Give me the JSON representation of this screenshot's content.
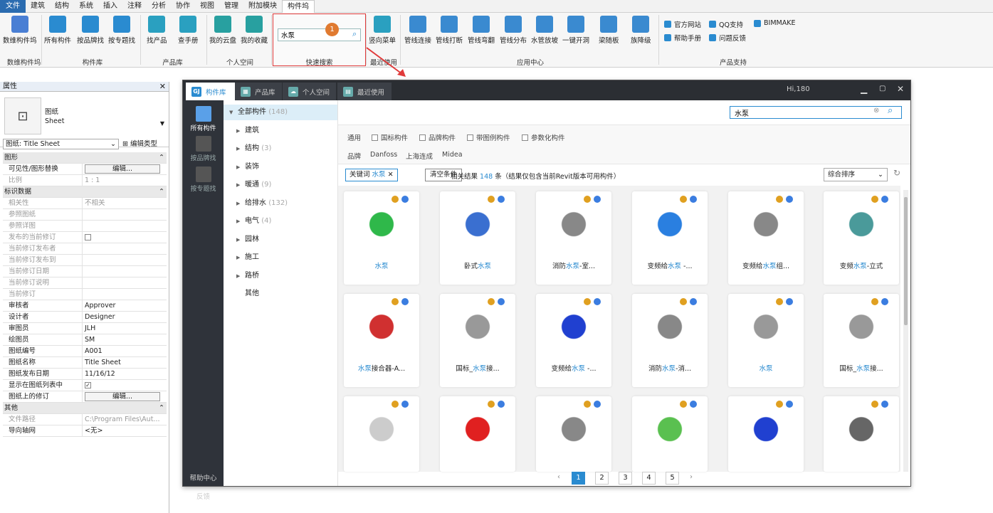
{
  "menu": [
    "文件",
    "建筑",
    "结构",
    "系统",
    "插入",
    "注释",
    "分析",
    "协作",
    "视图",
    "管理",
    "附加模块",
    "构件坞"
  ],
  "ribbon": {
    "buttons": [
      {
        "label": "数维构件坞",
        "color": "#4a7fd4",
        "icon": "hand-icon"
      },
      {
        "label": "所有构件",
        "color": "#2a8bd0",
        "icon": "gj-icon"
      },
      {
        "label": "按品牌找",
        "color": "#2a8bd0",
        "icon": "brand-icon"
      },
      {
        "label": "按专题找",
        "color": "#2a8bd0",
        "icon": "topic-icon"
      },
      {
        "label": "找产品",
        "color": "#2aa0c0",
        "icon": "product-icon"
      },
      {
        "label": "查手册",
        "color": "#2aa0c0",
        "icon": "manual-icon"
      },
      {
        "label": "我的云盘",
        "color": "#28a0a0",
        "icon": "cloud-icon"
      },
      {
        "label": "我的收藏",
        "color": "#28a0a0",
        "icon": "star-icon"
      },
      {
        "label": "竖向菜单",
        "color": "#2aa0c0",
        "icon": "vertical-menu-icon"
      },
      {
        "label": "管线连接",
        "color": "#3a8ad0",
        "icon": "pipe-connect-icon"
      },
      {
        "label": "管线打断",
        "color": "#3a8ad0",
        "icon": "pipe-break-icon"
      },
      {
        "label": "管线弯翻",
        "color": "#3a8ad0",
        "icon": "pipe-bend-icon"
      },
      {
        "label": "管线分布",
        "color": "#3a8ad0",
        "icon": "pipe-distribute-icon"
      },
      {
        "label": "水管放坡",
        "color": "#3a8ad0",
        "icon": "pipe-slope-icon"
      },
      {
        "label": "一键开洞",
        "color": "#3a8ad0",
        "icon": "hole-icon"
      },
      {
        "label": "梁随板",
        "color": "#3a8ad0",
        "icon": "beam-icon"
      },
      {
        "label": "族降级",
        "color": "#3a8ad0",
        "icon": "family-downgrade-icon"
      }
    ],
    "groups": [
      "数维构件坞",
      "构件库",
      "产品库",
      "个人空间",
      "快速搜索",
      "最近使用",
      "应用中心",
      "产品支持"
    ],
    "quick_search": {
      "value": "水泵",
      "badge": "1"
    },
    "support": [
      "官方网站",
      "QQ支持",
      "BIMMAKE",
      "帮助手册",
      "问题反馈"
    ]
  },
  "props": {
    "title": "属性",
    "type_name": "图纸",
    "type_sub": "Sheet",
    "selector": "图纸: Title Sheet",
    "edit_type": "编辑类型",
    "rows": [
      {
        "k": "图形",
        "v": "",
        "sec": true
      },
      {
        "k": "可见性/图形替换",
        "v": "编辑...",
        "btn": true
      },
      {
        "k": "比例",
        "v": "1 : 1",
        "dim": true
      },
      {
        "k": "标识数据",
        "v": "",
        "sec": true
      },
      {
        "k": "相关性",
        "v": "不相关",
        "dim": true
      },
      {
        "k": "参照图纸",
        "v": "",
        "dim": true
      },
      {
        "k": "参照详图",
        "v": "",
        "dim": true
      },
      {
        "k": "发布的当前修订",
        "v": "",
        "cb": "",
        "dim": true
      },
      {
        "k": "当前修订发布者",
        "v": "",
        "dim": true
      },
      {
        "k": "当前修订发布到",
        "v": "",
        "dim": true
      },
      {
        "k": "当前修订日期",
        "v": "",
        "dim": true
      },
      {
        "k": "当前修订说明",
        "v": "",
        "dim": true
      },
      {
        "k": "当前修订",
        "v": "",
        "dim": true
      },
      {
        "k": "审核者",
        "v": "Approver"
      },
      {
        "k": "设计者",
        "v": "Designer"
      },
      {
        "k": "审图员",
        "v": "JLH"
      },
      {
        "k": "绘图员",
        "v": "SM"
      },
      {
        "k": "图纸编号",
        "v": "A001"
      },
      {
        "k": "图纸名称",
        "v": "Title Sheet"
      },
      {
        "k": "图纸发布日期",
        "v": "11/16/12"
      },
      {
        "k": "显示在图纸列表中",
        "v": "",
        "cb": "✓"
      },
      {
        "k": "图纸上的修订",
        "v": "编辑...",
        "btn": true
      },
      {
        "k": "其他",
        "v": "",
        "sec": true
      },
      {
        "k": "文件路径",
        "v": "C:\\Program Files\\Aut...",
        "dim": true
      },
      {
        "k": "导向轴网",
        "v": "<无>"
      }
    ]
  },
  "dialog": {
    "tabs": [
      "构件库",
      "产品库",
      "个人空间",
      "最近使用"
    ],
    "greeting": "Hi,180",
    "sidebar": [
      "所有构件",
      "按品牌找",
      "按专题找"
    ],
    "help_center": "帮助中心",
    "feedback": "反馈",
    "tree": [
      {
        "label": "全部构件",
        "count": "(148)",
        "root": true
      },
      {
        "label": "建筑",
        "count": ""
      },
      {
        "label": "结构",
        "count": "(3)"
      },
      {
        "label": "装饰",
        "count": ""
      },
      {
        "label": "暖通",
        "count": "(9)"
      },
      {
        "label": "给排水",
        "count": "(132)"
      },
      {
        "label": "电气",
        "count": "(4)"
      },
      {
        "label": "园林",
        "count": ""
      },
      {
        "label": "施工",
        "count": ""
      },
      {
        "label": "路桥",
        "count": ""
      },
      {
        "label": "其他",
        "count": "",
        "leaf": true
      }
    ],
    "search_value": "水泵",
    "filter_general_label": "通用",
    "filters": [
      "国标构件",
      "品牌构件",
      "带图例构件",
      "参数化构件"
    ],
    "brand_label": "品牌",
    "brands": [
      "Danfoss",
      "上海连成",
      "Midea"
    ],
    "keyword_prefix": "关键词",
    "keyword": "水泵",
    "clear_label": "清空条件",
    "result_prefix": "相关结果",
    "result_count": "148",
    "result_suffix": "条（结果仅包含当前Revit版本可用构件）",
    "sort": "综合排序",
    "cards": [
      {
        "pre": "",
        "hl": "水泵",
        "post": "",
        "color": "#2fb84a"
      },
      {
        "pre": "卧式",
        "hl": "水泵",
        "post": "",
        "color": "#3a6fd0"
      },
      {
        "pre": "消防",
        "hl": "水泵",
        "post": "-室...",
        "color": "#888"
      },
      {
        "pre": "变频给",
        "hl": "水泵",
        "post": " -...",
        "color": "#2a7fe0"
      },
      {
        "pre": "变频给",
        "hl": "水泵",
        "post": "组...",
        "color": "#888"
      },
      {
        "pre": "变频",
        "hl": "水泵",
        "post": "-立式",
        "color": "#4a9a9a"
      },
      {
        "pre": "",
        "hl": "水泵",
        "post": "接合器-A...",
        "color": "#d03030"
      },
      {
        "pre": "国标_",
        "hl": "水泵",
        "post": "接...",
        "color": "#999"
      },
      {
        "pre": "变频给",
        "hl": "水泵",
        "post": " -...",
        "color": "#2040d0"
      },
      {
        "pre": "消防",
        "hl": "水泵",
        "post": "-消...",
        "color": "#888"
      },
      {
        "pre": "",
        "hl": "水泵",
        "post": "",
        "color": "#999"
      },
      {
        "pre": "国标_",
        "hl": "水泵",
        "post": "接...",
        "color": "#999"
      },
      {
        "pre": "",
        "hl": "",
        "post": "",
        "color": "#ccc"
      },
      {
        "pre": "",
        "hl": "",
        "post": "",
        "color": "#e02020"
      },
      {
        "pre": "",
        "hl": "",
        "post": "",
        "color": "#888"
      },
      {
        "pre": "",
        "hl": "",
        "post": "",
        "color": "#5ac050"
      },
      {
        "pre": "",
        "hl": "",
        "post": "",
        "color": "#2040d0"
      },
      {
        "pre": "",
        "hl": "",
        "post": "",
        "color": "#666"
      }
    ],
    "pages": [
      "1",
      "2",
      "3",
      "4",
      "5"
    ]
  }
}
